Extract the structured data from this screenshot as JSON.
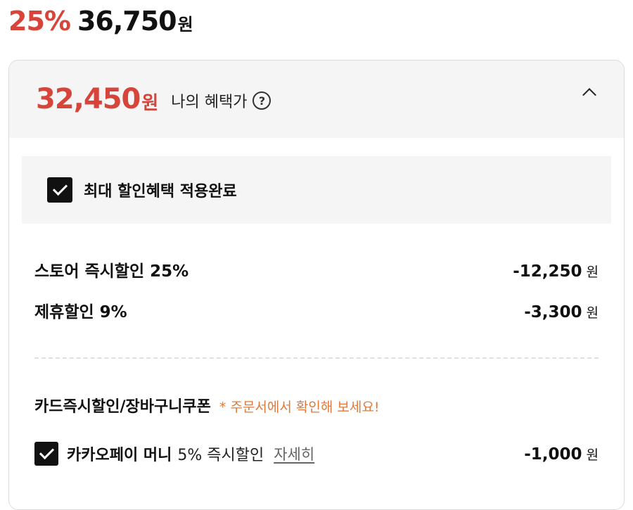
{
  "price": {
    "discount_rate": "25%",
    "amount": "36,750",
    "currency": "원"
  },
  "benefit": {
    "price": "32,450",
    "currency": "원",
    "label": "나의 혜택가",
    "help_icon": "question-circle-icon",
    "toggle_icon": "chevron-up-icon",
    "applied_label": "최대 할인혜택 적용완료",
    "rows": [
      {
        "name": "스토어 즉시할인 25%",
        "value": "-12,250",
        "unit": "원"
      },
      {
        "name": "제휴할인 9%",
        "value": "-3,300",
        "unit": "원"
      }
    ],
    "card_section": {
      "title": "카드즉시할인/장바구니쿠폰",
      "note": "* 주문서에서 확인해 보세요!",
      "kakao_name": "카카오페이 머니",
      "kakao_desc": "5% 즉시할인",
      "detail_link": "자세히",
      "kakao_value": "-1,000",
      "kakao_unit": "원"
    }
  },
  "colors": {
    "accent_red": "#d7443a",
    "note_orange": "#e07a3a"
  }
}
